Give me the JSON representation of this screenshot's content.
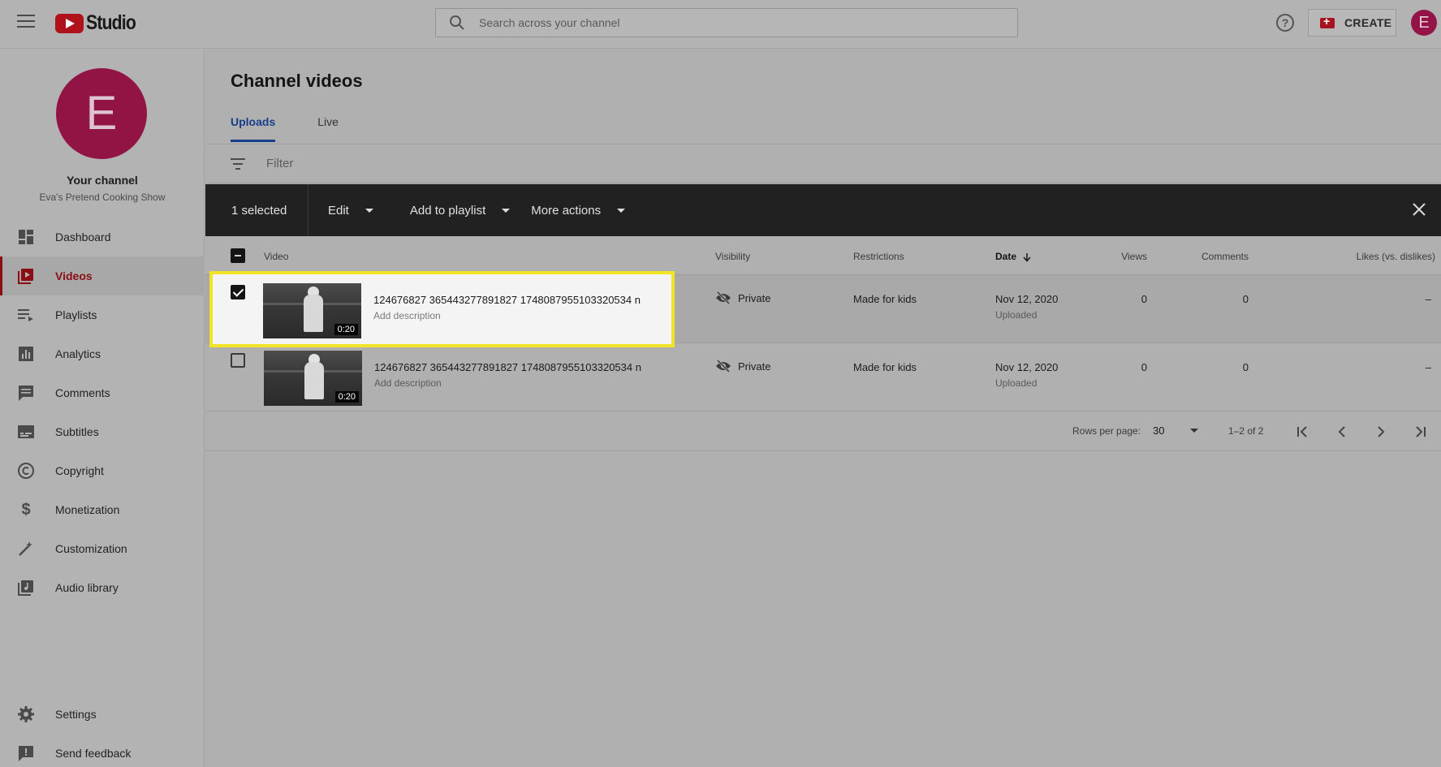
{
  "header": {
    "logo_text": "Studio",
    "search_placeholder": "Search across your channel",
    "create_label": "CREATE",
    "avatar_letter": "E"
  },
  "sidebar": {
    "avatar_letter": "E",
    "your_channel": "Your channel",
    "channel_name": "Eva's Pretend Cooking Show",
    "items": [
      {
        "label": "Dashboard",
        "icon": "dashboard-icon"
      },
      {
        "label": "Videos",
        "icon": "videos-icon",
        "active": true
      },
      {
        "label": "Playlists",
        "icon": "playlists-icon"
      },
      {
        "label": "Analytics",
        "icon": "analytics-icon"
      },
      {
        "label": "Comments",
        "icon": "comments-icon"
      },
      {
        "label": "Subtitles",
        "icon": "subtitles-icon"
      },
      {
        "label": "Copyright",
        "icon": "copyright-icon"
      },
      {
        "label": "Monetization",
        "icon": "monetization-icon"
      },
      {
        "label": "Customization",
        "icon": "customization-icon"
      },
      {
        "label": "Audio library",
        "icon": "audio-library-icon"
      }
    ],
    "bottom_items": [
      {
        "label": "Settings",
        "icon": "gear-icon"
      },
      {
        "label": "Send feedback",
        "icon": "feedback-icon"
      }
    ]
  },
  "main": {
    "title": "Channel videos",
    "tabs": [
      {
        "label": "Uploads",
        "active": true
      },
      {
        "label": "Live"
      }
    ],
    "filter_placeholder": "Filter",
    "action_bar": {
      "selected": "1 selected",
      "edit": "Edit",
      "add_to_playlist": "Add to playlist",
      "more_actions": "More actions"
    },
    "columns": {
      "video": "Video",
      "visibility": "Visibility",
      "restrictions": "Restrictions",
      "date": "Date",
      "views": "Views",
      "comments": "Comments",
      "likes": "Likes (vs. dislikes)"
    },
    "rows": [
      {
        "title": "124676827 365443277891827 1748087955103320534 n",
        "description": "Add description",
        "duration": "0:20",
        "visibility": "Private",
        "restrictions": "Made for kids",
        "date": "Nov 12, 2020",
        "date_status": "Uploaded",
        "views": "0",
        "comments": "0",
        "likes": "–",
        "selected": true
      },
      {
        "title": "124676827 365443277891827 1748087955103320534 n",
        "description": "Add description",
        "duration": "0:20",
        "visibility": "Private",
        "restrictions": "Made for kids",
        "date": "Nov 12, 2020",
        "date_status": "Uploaded",
        "views": "0",
        "comments": "0",
        "likes": "–",
        "selected": false
      }
    ],
    "pagination": {
      "rows_per_page_label": "Rows per page:",
      "rows_per_page": "30",
      "range": "1–2 of 2"
    }
  },
  "colors": {
    "accent_red": "#8a0e14",
    "tab_blue": "#173e8a",
    "highlight_yellow": "#f1e425",
    "avatar": "#911445"
  }
}
